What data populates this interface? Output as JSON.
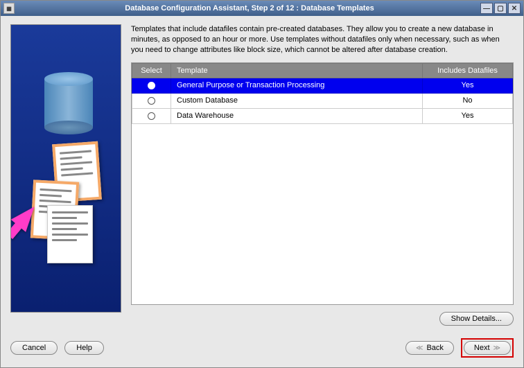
{
  "window": {
    "title": "Database Configuration Assistant, Step 2 of 12 : Database Templates"
  },
  "description": "Templates that include datafiles contain pre-created databases. They allow you to create a new database in minutes, as opposed to an hour or more. Use templates without datafiles only when necessary, such as when you need to change attributes like block size, which cannot be altered after database creation.",
  "table": {
    "headers": {
      "select": "Select",
      "template": "Template",
      "includes": "Includes Datafiles"
    },
    "rows": [
      {
        "template": "General Purpose or Transaction Processing",
        "includes": "Yes",
        "selected": true
      },
      {
        "template": "Custom Database",
        "includes": "No",
        "selected": false
      },
      {
        "template": "Data Warehouse",
        "includes": "Yes",
        "selected": false
      }
    ]
  },
  "buttons": {
    "show_details": "Show Details...",
    "cancel": "Cancel",
    "help": "Help",
    "back": "Back",
    "next": "Next"
  }
}
